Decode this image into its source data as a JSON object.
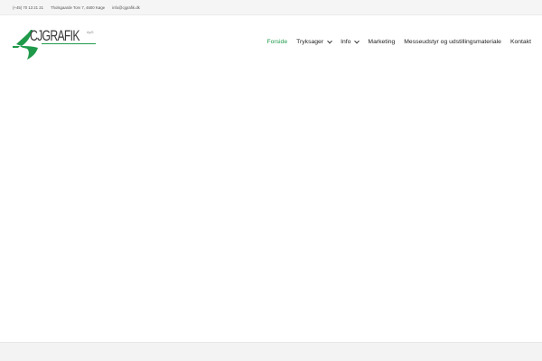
{
  "topbar": {
    "phone": "(+45) 70 13 21 21",
    "address": "Tholsgaarde Torv 7, 4600 Køge",
    "email": "info@cjgrafik.dk"
  },
  "logo": {
    "text": "CJGRAFIK",
    "small": "ApS",
    "accent_color": "#1f9a4a"
  },
  "nav": {
    "items": [
      {
        "label": "Forside",
        "active": true,
        "has_dropdown": false
      },
      {
        "label": "Tryksager",
        "active": false,
        "has_dropdown": true
      },
      {
        "label": "Info",
        "active": false,
        "has_dropdown": true
      },
      {
        "label": "Marketing",
        "active": false,
        "has_dropdown": false
      },
      {
        "label": "Messeudstyr og udstillingsmateriale",
        "active": false,
        "has_dropdown": false
      },
      {
        "label": "Kontakt",
        "active": false,
        "has_dropdown": false
      }
    ],
    "active_color": "#1f9a4a",
    "dropdown_icon": "chevron-down-icon"
  }
}
